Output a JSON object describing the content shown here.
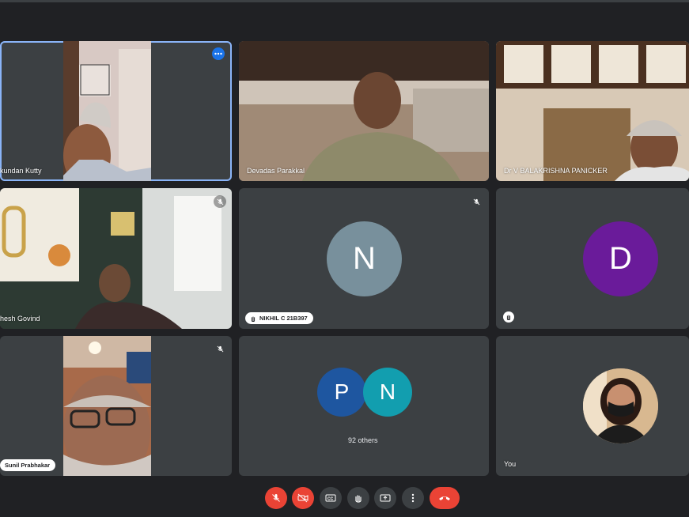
{
  "participants": {
    "mukundan": {
      "name": "kundan Kutty"
    },
    "devadas": {
      "name": "Devadas Parakkal"
    },
    "balakrishna": {
      "name": "Dr V BALAKRISHNA PANICKER"
    },
    "govind": {
      "name": "hesh Govind"
    },
    "nikhil": {
      "name": "NIKHIL C 21B397",
      "initial": "N",
      "avatar_color": "#78909c"
    },
    "d_user": {
      "initial": "D",
      "avatar_color": "#6a1b9a"
    },
    "sunil": {
      "name": "Sunil Prabhakar"
    },
    "others": {
      "initial_1": "P",
      "color_1": "#1e56a0",
      "initial_2": "N",
      "color_2": "#129eaf",
      "label": "92 others"
    },
    "self": {
      "name": "You"
    }
  },
  "toolbar": {
    "buttons": [
      "mic-off",
      "camera-off",
      "captions",
      "raise-hand",
      "present",
      "more-options",
      "leave-call"
    ]
  },
  "colors": {
    "tile_bg": "#3c4043",
    "page_bg": "#202124",
    "danger": "#ea4335",
    "active_outline": "#8ab4f8"
  }
}
